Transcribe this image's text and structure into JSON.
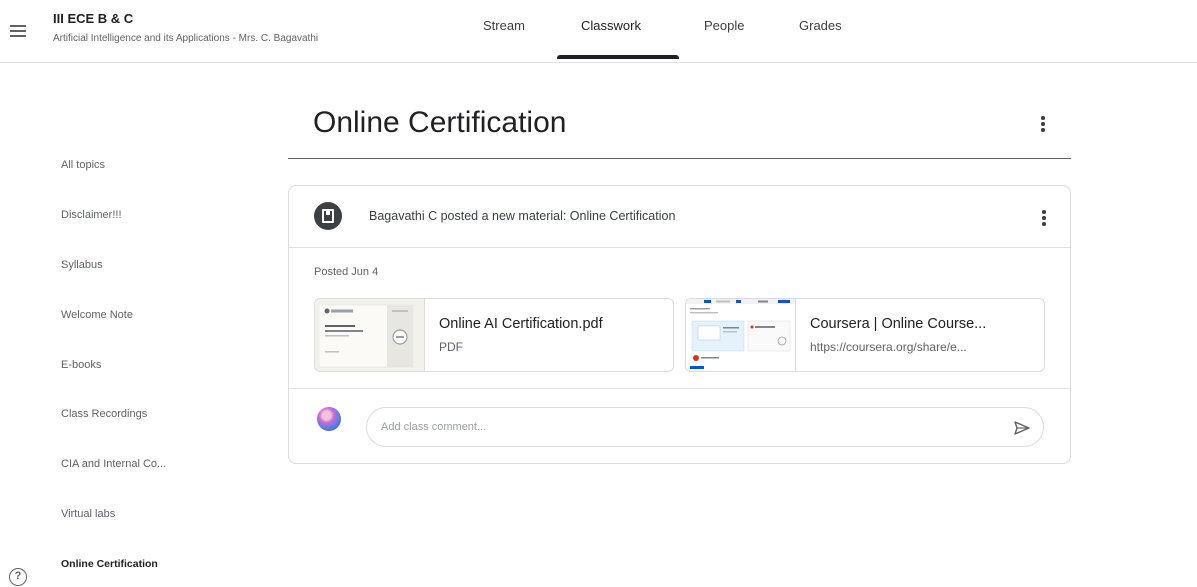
{
  "header": {
    "class_name": "III ECE B & C",
    "class_subtitle": "Artificial Intelligence and its Applications - Mrs. C. Bagavathi",
    "tabs": [
      {
        "label": "Stream"
      },
      {
        "label": "Classwork"
      },
      {
        "label": "People"
      },
      {
        "label": "Grades"
      }
    ],
    "active_tab": "Classwork"
  },
  "sidebar": {
    "items": [
      {
        "label": "All topics"
      },
      {
        "label": "Disclaimer!!!"
      },
      {
        "label": "Syllabus"
      },
      {
        "label": "Welcome Note"
      },
      {
        "label": "E-books"
      },
      {
        "label": "Class Recordings"
      },
      {
        "label": "CIA and Internal Co..."
      },
      {
        "label": "Virtual labs"
      },
      {
        "label": "Online Certification"
      }
    ],
    "active_item": "Online Certification"
  },
  "topic": {
    "title": "Online Certification"
  },
  "post": {
    "text": "Bagavathi C posted a new material: Online Certification",
    "date": "Posted Jun 4",
    "attachments": [
      {
        "title": "Online AI Certification.pdf",
        "subtitle": "PDF"
      },
      {
        "title": "Coursera | Online Course...",
        "subtitle": "https://coursera.org/share/e..."
      }
    ],
    "comment_placeholder": "Add class comment..."
  },
  "colors": {
    "text_primary": "#202124",
    "text_secondary": "#5f6368",
    "border": "#dadce0",
    "coursera_blue": "#0056d2"
  }
}
